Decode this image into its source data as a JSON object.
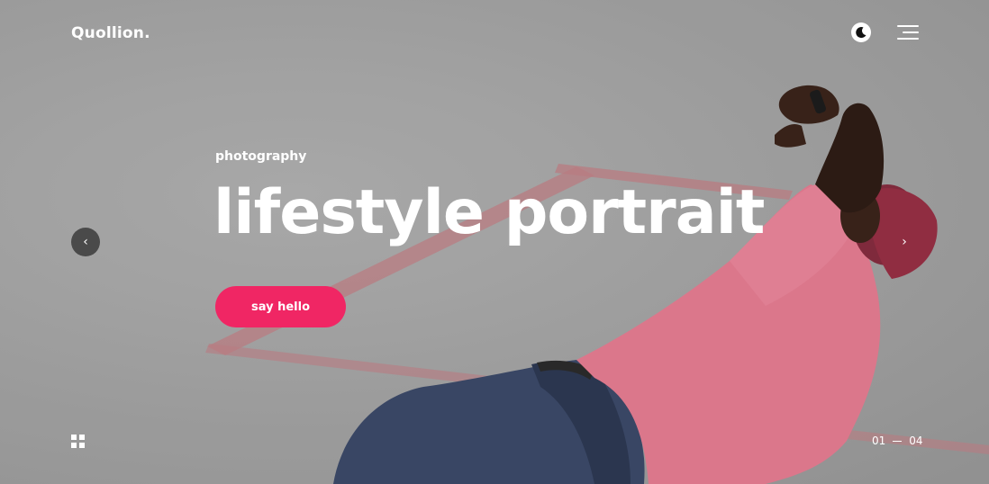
{
  "header": {
    "logo": "Quollion.",
    "theme_icon": "moon-icon",
    "menu_icon": "hamburger-menu-icon"
  },
  "slide": {
    "eyebrow": "photography",
    "title": "lifestyle portrait",
    "cta_label": "say hello"
  },
  "nav": {
    "prev_icon": "chevron-left-icon",
    "next_icon": "chevron-right-icon",
    "prev_glyph": "‹",
    "next_glyph": "›"
  },
  "footer": {
    "grid_icon": "grid-icon",
    "pager_current": "01",
    "pager_total": "04"
  },
  "colors": {
    "accent": "#f02664",
    "shirt": "#f08097",
    "jeans": "#3b4a6b",
    "background": "#b0b0b0"
  }
}
